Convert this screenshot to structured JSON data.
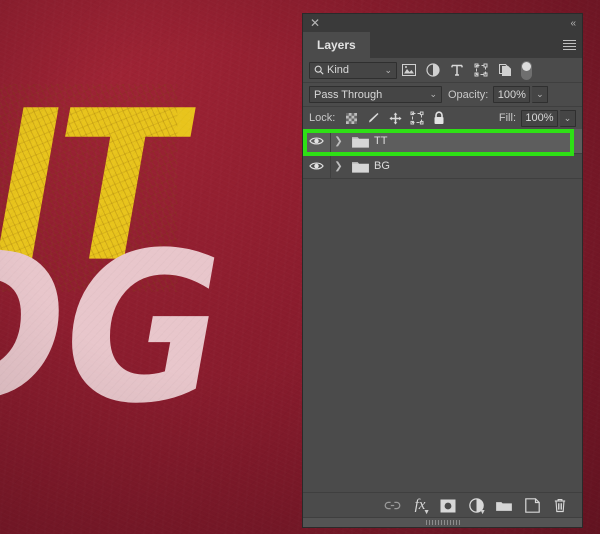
{
  "artwork": {
    "line1": "FIT",
    "line2": "DG",
    "bg_color": "#8a1c2d",
    "yellow_color": "#e8c41c",
    "pink_color": "#e8c6cb"
  },
  "panel": {
    "close_icon": "close-icon",
    "collapse_icon": "collapse-to-icons-icon",
    "tab_label": "Layers",
    "menu_icon": "panel-menu-icon",
    "highlight_color": "#2ee015"
  },
  "filter": {
    "kind_label": "Kind",
    "search_icon": "search-icon",
    "chevron": "⌄",
    "icons": [
      {
        "name": "filter-pixel-layers-icon",
        "title": "Pixel layers"
      },
      {
        "name": "filter-adjustment-layers-icon",
        "title": "Adjustment layers"
      },
      {
        "name": "filter-type-layers-icon",
        "title": "Type layers"
      },
      {
        "name": "filter-shape-layers-icon",
        "title": "Shape layers"
      },
      {
        "name": "filter-smart-objects-icon",
        "title": "Smart objects"
      }
    ],
    "toggle_name": "filter-enable-toggle"
  },
  "blend": {
    "mode": "Pass Through",
    "chevron": "⌄",
    "opacity_label": "Opacity:",
    "opacity_value": "100%",
    "stepper": "⌄"
  },
  "lock": {
    "label": "Lock:",
    "icons": [
      {
        "name": "lock-transparent-pixels-icon"
      },
      {
        "name": "lock-image-pixels-icon"
      },
      {
        "name": "lock-position-icon"
      },
      {
        "name": "lock-artboard-nesting-icon"
      },
      {
        "name": "lock-all-icon"
      }
    ],
    "fill_label": "Fill:",
    "fill_value": "100%",
    "stepper": "⌄"
  },
  "layers": [
    {
      "name": "TT",
      "visible": true,
      "kind": "group",
      "selected": true,
      "expanded": false,
      "chevron": "❯"
    },
    {
      "name": "BG",
      "visible": true,
      "kind": "group",
      "selected": false,
      "expanded": false,
      "chevron": "❯"
    }
  ],
  "bottom_toolbar": [
    {
      "name": "link-layers-icon",
      "label": "Link layers"
    },
    {
      "name": "layer-style-fx-icon",
      "label": "fx"
    },
    {
      "name": "add-layer-mask-icon",
      "label": "Add layer mask"
    },
    {
      "name": "new-adjustment-layer-icon",
      "label": "New fill or adjustment layer"
    },
    {
      "name": "new-group-icon",
      "label": "Create a new group"
    },
    {
      "name": "new-layer-icon",
      "label": "Create a new layer"
    },
    {
      "name": "delete-layer-icon",
      "label": "Delete layer"
    }
  ],
  "resize_grip": "panel-resize-grip"
}
